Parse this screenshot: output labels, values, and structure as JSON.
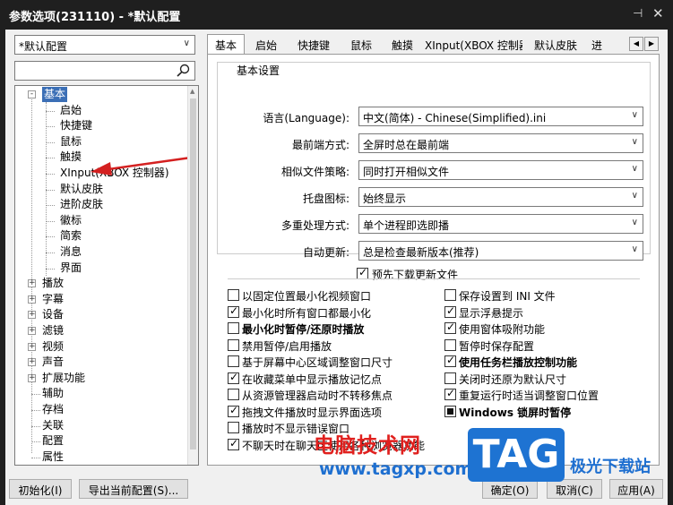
{
  "window": {
    "title": "参数选项(231110) - *默认配置"
  },
  "profile": {
    "value": "*默认配置"
  },
  "tree": {
    "items": [
      {
        "label": "基本",
        "expander": "-",
        "selected": true
      },
      {
        "label": "启始"
      },
      {
        "label": "快捷键"
      },
      {
        "label": "鼠标"
      },
      {
        "label": "触摸"
      },
      {
        "label": "XInput(XBOX 控制器)"
      },
      {
        "label": "默认皮肤"
      },
      {
        "label": "进阶皮肤"
      },
      {
        "label": "徽标"
      },
      {
        "label": "简索"
      },
      {
        "label": "消息"
      },
      {
        "label": "界面"
      },
      {
        "label": "播放",
        "expander": "+"
      },
      {
        "label": "字幕",
        "expander": "+"
      },
      {
        "label": "设备",
        "expander": "+"
      },
      {
        "label": "滤镜",
        "expander": "+"
      },
      {
        "label": "视频",
        "expander": "+"
      },
      {
        "label": "声音",
        "expander": "+"
      },
      {
        "label": "扩展功能",
        "expander": "+"
      },
      {
        "label": "辅助"
      },
      {
        "label": "存档"
      },
      {
        "label": "关联"
      },
      {
        "label": "配置"
      },
      {
        "label": "属性"
      }
    ]
  },
  "tabs": [
    "基本",
    "启始",
    "快捷键",
    "鼠标",
    "触摸",
    "XInput(XBOX 控制器)",
    "默认皮肤",
    "进"
  ],
  "basic": {
    "group_title": "基本设置",
    "fields": [
      {
        "label": "语言(Language):",
        "value": "中文(简体) - Chinese(Simplified).ini"
      },
      {
        "label": "最前端方式:",
        "value": "全屏时总在最前端"
      },
      {
        "label": "相似文件策略:",
        "value": "同时打开相似文件"
      },
      {
        "label": "托盘图标:",
        "value": "始终显示"
      },
      {
        "label": "多重处理方式:",
        "value": "单个进程即选即播"
      },
      {
        "label": "自动更新:",
        "value": "总是检查最新版本(推荐)"
      }
    ],
    "predownload": "预先下载更新文件"
  },
  "options_left": [
    {
      "label": "以固定位置最小化视频窗口",
      "checked": false
    },
    {
      "label": "最小化时所有窗口都最小化",
      "checked": true
    },
    {
      "label": "最小化时暂停/还原时播放",
      "checked": false,
      "bold": true
    },
    {
      "label": "禁用暂停/启用播放",
      "checked": false
    },
    {
      "label": "基于屏幕中心区域调整窗口尺寸",
      "checked": false
    },
    {
      "label": "在收藏菜单中显示播放记忆点",
      "checked": true
    },
    {
      "label": "从资源管理器启动时不转移焦点",
      "checked": false
    },
    {
      "label": "拖拽文件播放时显示界面选项",
      "checked": true
    },
    {
      "label": "播放时不显示错误窗口",
      "checked": false
    },
    {
      "label": "不聊天时在聊天区使用各种浏览器功能",
      "checked": true
    }
  ],
  "options_right": [
    {
      "label": "保存设置到 INI 文件",
      "checked": false
    },
    {
      "label": "显示浮悬提示",
      "checked": true
    },
    {
      "label": "使用窗体吸附功能",
      "checked": true
    },
    {
      "label": "暂停时保存配置",
      "checked": false
    },
    {
      "label": "使用任务栏播放控制功能",
      "checked": true,
      "bold": true
    },
    {
      "label": "关闭时还原为默认尺寸",
      "checked": false
    },
    {
      "label": "重复运行时适当调整窗口位置",
      "checked": true
    },
    {
      "label": "Windows 锁屏时暂停",
      "checked": "partial",
      "bold": true
    }
  ],
  "buttons": {
    "init": "初始化(I)",
    "export": "导出当前配置(S)...",
    "ok": "确定(O)",
    "cancel": "取消(C)",
    "apply": "应用(A)"
  },
  "watermark": {
    "line1": "电脑技术网",
    "line2": "www.tagxp.com",
    "tag": "TAG",
    "site": "极光下载站"
  }
}
